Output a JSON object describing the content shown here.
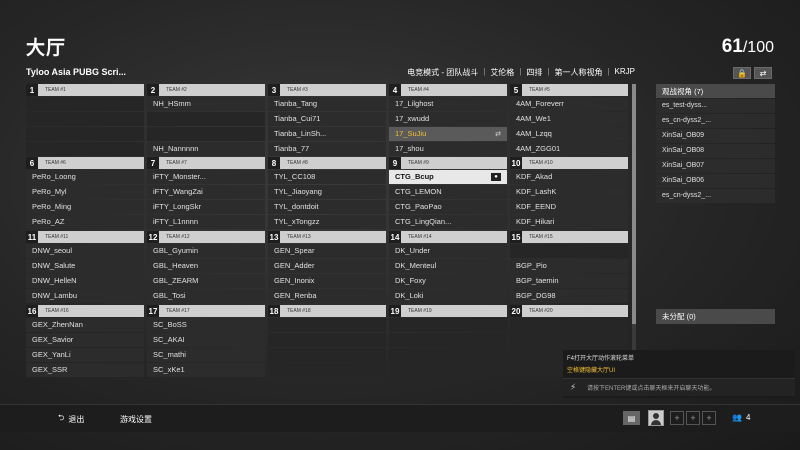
{
  "header": {
    "title": "大厅",
    "count_current": "61",
    "count_total": "/100"
  },
  "room": {
    "name": "Tyloo Asia PUBG Scri...",
    "info": [
      "电竞模式 - 团队战斗",
      "艾伦格",
      "四排",
      "第一人称视角",
      "KRJP"
    ]
  },
  "top_icons": [
    {
      "icon": "lock-icon",
      "glyph": "🔒"
    },
    {
      "icon": "swap-icon",
      "glyph": "⇄"
    }
  ],
  "teams": [
    {
      "num": "1",
      "label": "TEAM #1",
      "players": [
        "",
        "",
        "",
        ""
      ]
    },
    {
      "num": "2",
      "label": "TEAM #2",
      "players": [
        "NH_HSmm",
        "",
        "",
        "NH_Nannnnn"
      ]
    },
    {
      "num": "3",
      "label": "TEAM #3",
      "players": [
        "Tianba_Tang",
        "Tianba_Cui71",
        "Tianba_LinSh...",
        "Tianba_77"
      ]
    },
    {
      "num": "4",
      "label": "TEAM #4",
      "players": [
        "17_Lilghost",
        "17_xwudd",
        "17_SuJiu",
        "17_shou"
      ],
      "highlight": 2
    },
    {
      "num": "5",
      "label": "TEAM #5",
      "players": [
        "4AM_Foreverr",
        "4AM_We1",
        "4AM_Lzqq",
        "4AM_ZGG01"
      ]
    },
    {
      "num": "6",
      "label": "TEAM #6",
      "players": [
        "PeRo_Loong",
        "PeRo_Myl",
        "PeRo_Ming",
        "PeRo_AZ"
      ]
    },
    {
      "num": "7",
      "label": "TEAM #7",
      "players": [
        "iFTY_Monster...",
        "iFTY_WangZai",
        "iFTY_LongSkr",
        "iFTY_L1nnnn"
      ]
    },
    {
      "num": "8",
      "label": "TEAM #8",
      "players": [
        "TYL_CC108",
        "TYL_Jiaoyang",
        "TYL_dontdoit",
        "TYL_xTongzz"
      ]
    },
    {
      "num": "9",
      "label": "TEAM #9",
      "players": [
        "CTG_Bcup",
        "CTG_LEMON",
        "CTG_PaoPao",
        "CTG_LingQian..."
      ],
      "selected": 0
    },
    {
      "num": "10",
      "label": "TEAM #10",
      "players": [
        "KDF_Akad",
        "KDF_LashK",
        "KDF_EEND",
        "KDF_Hikari"
      ]
    },
    {
      "num": "11",
      "label": "TEAM #11",
      "players": [
        "DNW_seoul",
        "DNW_Salute",
        "DNW_HelleN",
        "DNW_Lambu"
      ]
    },
    {
      "num": "12",
      "label": "TEAM #12",
      "players": [
        "GBL_Gyumin",
        "GBL_Heaven",
        "GBL_ZEARM",
        "GBL_Tosi"
      ]
    },
    {
      "num": "13",
      "label": "TEAM #13",
      "players": [
        "GEN_Spear",
        "GEN_Adder",
        "GEN_Inonix",
        "GEN_Renba"
      ]
    },
    {
      "num": "14",
      "label": "TEAM #14",
      "players": [
        "DK_Under",
        "DK_Menteul",
        "DK_Foxy",
        "DK_Loki"
      ]
    },
    {
      "num": "15",
      "label": "TEAM #15",
      "players": [
        "",
        "BGP_Pio",
        "BGP_taemin",
        "BGP_DG98"
      ]
    },
    {
      "num": "16",
      "label": "TEAM #16",
      "players": [
        "GEX_ZhenNan",
        "GEX_Savior",
        "GEX_YanLi",
        "GEX_SSR"
      ]
    },
    {
      "num": "17",
      "label": "TEAM #17",
      "players": [
        "SC_BoSS",
        "SC_AKAI",
        "SC_mathi",
        "SC_xKe1"
      ]
    },
    {
      "num": "18",
      "label": "TEAM #18",
      "players": [
        "",
        "",
        "",
        ""
      ]
    },
    {
      "num": "19",
      "label": "TEAM #19",
      "players": [
        "",
        "",
        "",
        ""
      ]
    },
    {
      "num": "20",
      "label": "TEAM #20",
      "players": [
        "",
        "",
        "",
        ""
      ]
    }
  ],
  "spectators": {
    "title": "观战视角 (7)",
    "list": [
      "es_test-dyss...",
      "es_cn-dyss2_...",
      "XinSai_OB09",
      "XinSai_OB08",
      "XinSai_OB07",
      "XinSai_OB06",
      "es_cn-dyss2_..."
    ]
  },
  "unassigned": "未分配 (0)",
  "popup": {
    "line1": "F4打开大厅动作滚轮菜单",
    "line2": "空格键隐藏大厅UI",
    "chat_hint": "请按下ENTER键或点击聊天框来开启聊天功能。"
  },
  "bottom": {
    "leave": "退出",
    "leave_icon": "⮌",
    "settings": "游戏设置",
    "users_count": "4"
  },
  "colors": {
    "highlight": "#f3c034"
  }
}
